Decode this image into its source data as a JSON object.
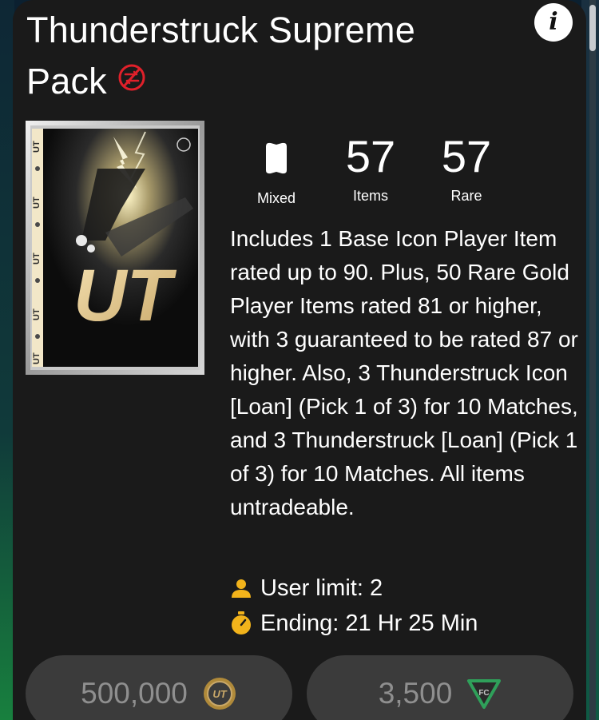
{
  "pack": {
    "title": "Thunderstruck Supreme Pack",
    "stats": [
      {
        "value": "",
        "label": "Mixed",
        "icon": "mixed-card-icon"
      },
      {
        "value": "57",
        "label": "Items"
      },
      {
        "value": "57",
        "label": "Rare"
      }
    ],
    "description": "Includes 1 Base Icon Player Item rated up to 90. Plus, 50 Rare Gold Player Items rated 81 or higher, with 3 guaranteed to be rated 87 or higher. Also, 3 Thunderstruck Icon [Loan] (Pick 1 of 3) for 10 Matches, and 3 Thunderstruck [Loan] (Pick 1 of 3) for 10 Matches. All items untradeable.",
    "user_limit": "User limit: 2",
    "ending": "Ending: 21 Hr 25 Min",
    "pack_art_text": "UT"
  },
  "buttons": {
    "coins": {
      "value": "500,000",
      "icon": "ut-coin-icon"
    },
    "points": {
      "value": "3,500",
      "icon": "fc-points-icon"
    }
  },
  "colors": {
    "accent": "#f2b31b",
    "untradeable": "#e0202a",
    "card_bg": "#1a1a1a",
    "button_bg": "#3b3b3b",
    "button_text": "#8f8f8f",
    "points_green": "#2fa05a"
  }
}
